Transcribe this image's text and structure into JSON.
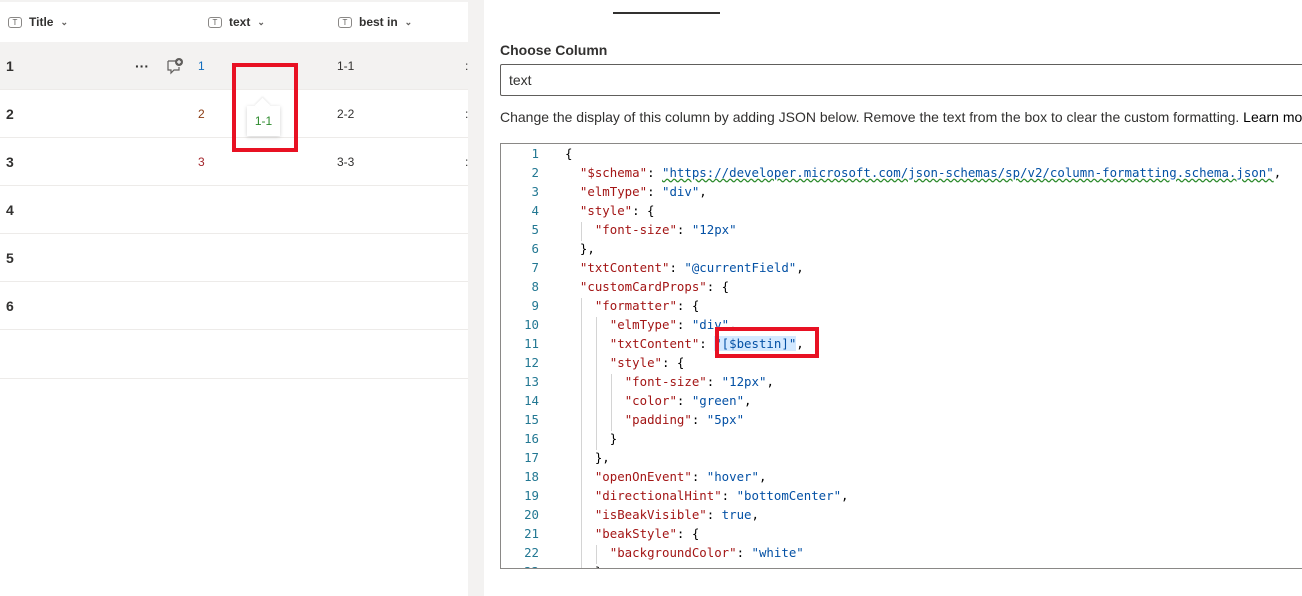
{
  "list": {
    "columns": [
      {
        "label": "Title",
        "icon": "text-column-icon"
      },
      {
        "label": "text",
        "icon": "text-column-icon"
      },
      {
        "label": "best in",
        "icon": "text-column-icon"
      }
    ],
    "rows": [
      {
        "title": "1",
        "text": "1",
        "best_in": "1-1"
      },
      {
        "title": "2",
        "text": "2",
        "best_in": "2-2"
      },
      {
        "title": "3",
        "text": "3",
        "best_in": "3-3"
      },
      {
        "title": "4",
        "text": "",
        "best_in": ""
      },
      {
        "title": "5",
        "text": "",
        "best_in": ""
      },
      {
        "title": "6",
        "text": "",
        "best_in": ""
      }
    ],
    "more_label": "···",
    "tooltip": "1-1",
    "text_colors": [
      "#0f6cbd",
      "#8a3b12",
      "#a4262c"
    ]
  },
  "panel": {
    "choose_column_label": "Choose Column",
    "selected_column": "text",
    "description": "Change the display of this column by adding JSON below. Remove the text from the box to clear the custom formatting. ",
    "learn_more": "Learn mo",
    "code_lines": [
      "{",
      "  \"$schema\": \"https://developer.microsoft.com/json-schemas/sp/v2/column-formatting.schema.json\",",
      "  \"elmType\": \"div\",",
      "  \"style\": {",
      "    \"font-size\": \"12px\"",
      "  },",
      "  \"txtContent\": \"@currentField\",",
      "  \"customCardProps\": {",
      "    \"formatter\": {",
      "      \"elmType\": \"div\",",
      "      \"txtContent\": \"[$bestin]\",",
      "      \"style\": {",
      "        \"font-size\": \"12px\",",
      "        \"color\": \"green\",",
      "        \"padding\": \"5px\"",
      "      }",
      "    },",
      "    \"openOnEvent\": \"hover\",",
      "    \"directionalHint\": \"bottomCenter\",",
      "    \"isBeakVisible\": true,",
      "    \"beakStyle\": {",
      "      \"backgroundColor\": \"white\"",
      "    }"
    ]
  }
}
